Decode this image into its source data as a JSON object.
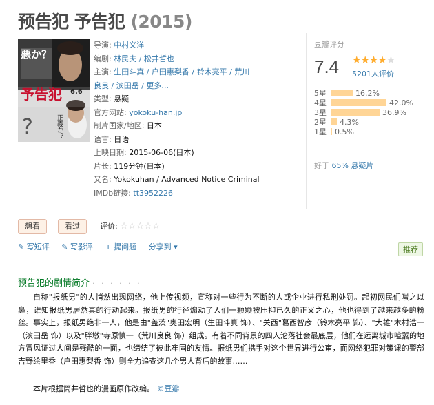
{
  "title": {
    "name": "预告犯 予告犯",
    "year": "(2015)"
  },
  "poster": {
    "top_left_text": "悪か？",
    "title_text": "予告犯",
    "date_text": "6.6",
    "side_text": "正義か？"
  },
  "info": {
    "director": {
      "label": "导演:",
      "value": "中村义洋"
    },
    "writer": {
      "label": "编剧:",
      "value": "林民夫 / 松井哲也"
    },
    "cast": {
      "label": "主演:",
      "line1": "生田斗真 / 户田惠梨香 / 铃木亮平 / 荒川",
      "line2": "良良 / 滨田岳 / 更多..."
    },
    "genre": {
      "label": "类型:",
      "value": "悬疑"
    },
    "website": {
      "label": "官方网站:",
      "value": "yokoku-han.jp"
    },
    "country": {
      "label": "制片国家/地区:",
      "value": "日本"
    },
    "language": {
      "label": "语言:",
      "value": "日语"
    },
    "release": {
      "label": "上映日期:",
      "value": "2015-06-06(日本)"
    },
    "runtime": {
      "label": "片长:",
      "value": "119分钟(日本)"
    },
    "aka": {
      "label": "又名:",
      "value": "Yokokuhan / Advanced Notice Criminal"
    },
    "imdb": {
      "label": "IMDb链接:",
      "value": "tt3952226"
    }
  },
  "rating": {
    "title": "豆瓣评分",
    "score": "7.4",
    "stars_filled": 4,
    "stars_total": 5,
    "votes": "5201人评价",
    "distribution": [
      {
        "star": "5星",
        "pct": "16.2%",
        "value": 16.2
      },
      {
        "star": "4星",
        "pct": "42.0%",
        "value": 42.0
      },
      {
        "star": "3星",
        "pct": "36.9%",
        "value": 36.9
      },
      {
        "star": "2星",
        "pct": "4.3%",
        "value": 4.3
      },
      {
        "star": "1星",
        "pct": "0.5%",
        "value": 0.5
      }
    ],
    "better_than_prefix": "好于",
    "better_than_link": "65% 悬疑片"
  },
  "buttons": {
    "want": "想看",
    "seen": "看过"
  },
  "rate_label": "评价:",
  "actions": {
    "review": "写短评",
    "longreview": "写影评",
    "question": "提问题",
    "share": "分享到",
    "recommend": "推荐"
  },
  "summary": {
    "heading": "预告犯的剧情简介",
    "heading_dots": "· · · · · ·",
    "para1": "自称\"报纸男\"的人悄然出现网络，他上传视频，宣称对一些行为不断的人或企业进行私刑处罚。起初网民们嗤之以鼻，谁知报纸男居然真的行动起来。报纸男的行径煽动了人们一颗颗被压抑已久的正义之心，他也得到了越来越多的粉丝。事实上，报纸男绝非一人，他是由\"盖茨\"奥田宏明（生田斗真 饰）、\"关西\"葛西智彦（铃木亮平 饰）、\"大雄\"木村浩一（滨田岳 饰）以及\"胖墩\"寺原慎一（荒川良良 饰）组成。有着不同背景的四人沦落社会最底层，他们在远离城市喧嚣的地方冒风证过人间是残酷的一面，也缔结了彼此牢固的友情。报纸男们携手对这个世界进行公审，而网络犯罪对策课的警部吉野绘里香（户田惠梨香 饰）则全力追查这几个男人背后的故事……",
    "para2": "本片根据筒井哲也的漫画原作改编。",
    "source": "©豆瓣"
  }
}
